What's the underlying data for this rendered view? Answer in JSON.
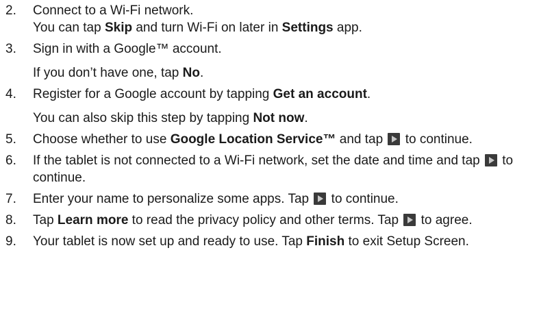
{
  "steps": [
    {
      "num": "2.",
      "l1": "Connect to a Wi-Fi network.",
      "l2a": "You can tap ",
      "l2b": "Skip",
      "l2c": " and turn Wi-Fi on later in ",
      "l2d": "Settings",
      "l2e": " app."
    },
    {
      "num": "3.",
      "l1": "Sign in with a Google™ account.",
      "l2a": "If you don’t have one, tap ",
      "l2b": "No",
      "l2c": "."
    },
    {
      "num": "4.",
      "l1a": "Register for a Google account by tapping ",
      "l1b": "Get an account",
      "l1c": ".",
      "l2a": "You can also skip this step by tapping ",
      "l2b": "Not now",
      "l2c": "."
    },
    {
      "num": "5.",
      "a": "Choose whether to use ",
      "b": "Google Location Service™",
      "c": " and tap ",
      "d": " to continue."
    },
    {
      "num": "6.",
      "a": "If the tablet is not connected to a Wi-Fi network, set the date and time and tap ",
      "b": " to continue."
    },
    {
      "num": "7.",
      "a": "Enter your name to personalize some apps. Tap ",
      "b": " to continue."
    },
    {
      "num": "8.",
      "a": "Tap ",
      "b": "Learn more",
      "c": " to read the privacy policy and other terms. Tap ",
      "d": " to agree."
    },
    {
      "num": "9.",
      "a": "Your tablet is now set up and ready to use. Tap ",
      "b": "Finish",
      "c": " to exit Setup Screen."
    }
  ],
  "icons": {
    "next": "play-arrow-icon"
  }
}
